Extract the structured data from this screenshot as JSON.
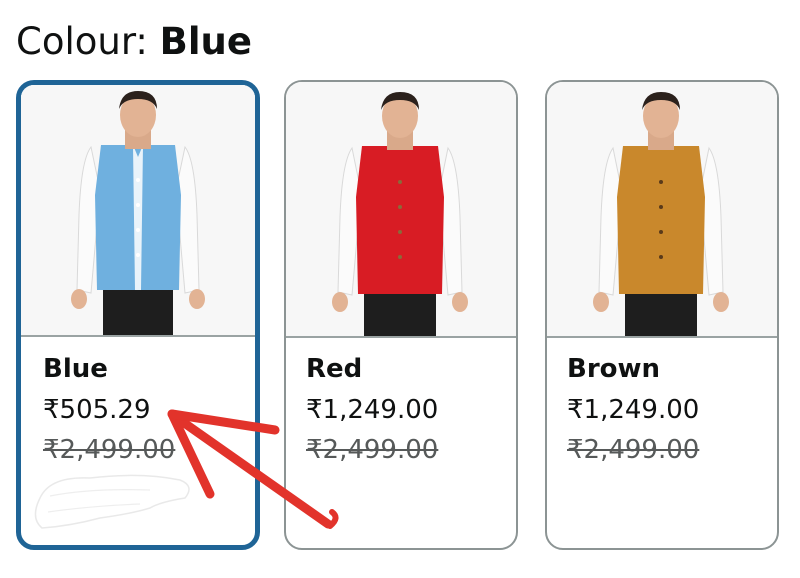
{
  "colour": {
    "label": "Colour: ",
    "selected": "Blue"
  },
  "options": [
    {
      "name": "Blue",
      "price": "₹505.29",
      "mrp": "₹2,499.00",
      "vest_color": "#6fb0df",
      "selected": true
    },
    {
      "name": "Red",
      "price": "₹1,249.00",
      "mrp": "₹2,499.00",
      "vest_color": "#d81c24",
      "selected": false
    },
    {
      "name": "Brown",
      "price": "₹1,249.00",
      "mrp": "₹2,499.00",
      "vest_color": "#c9882c",
      "selected": false
    }
  ],
  "colors": {
    "selected_border": "#1f6496",
    "card_border": "#8c9494",
    "annotation_arrow": "#e2332b"
  }
}
